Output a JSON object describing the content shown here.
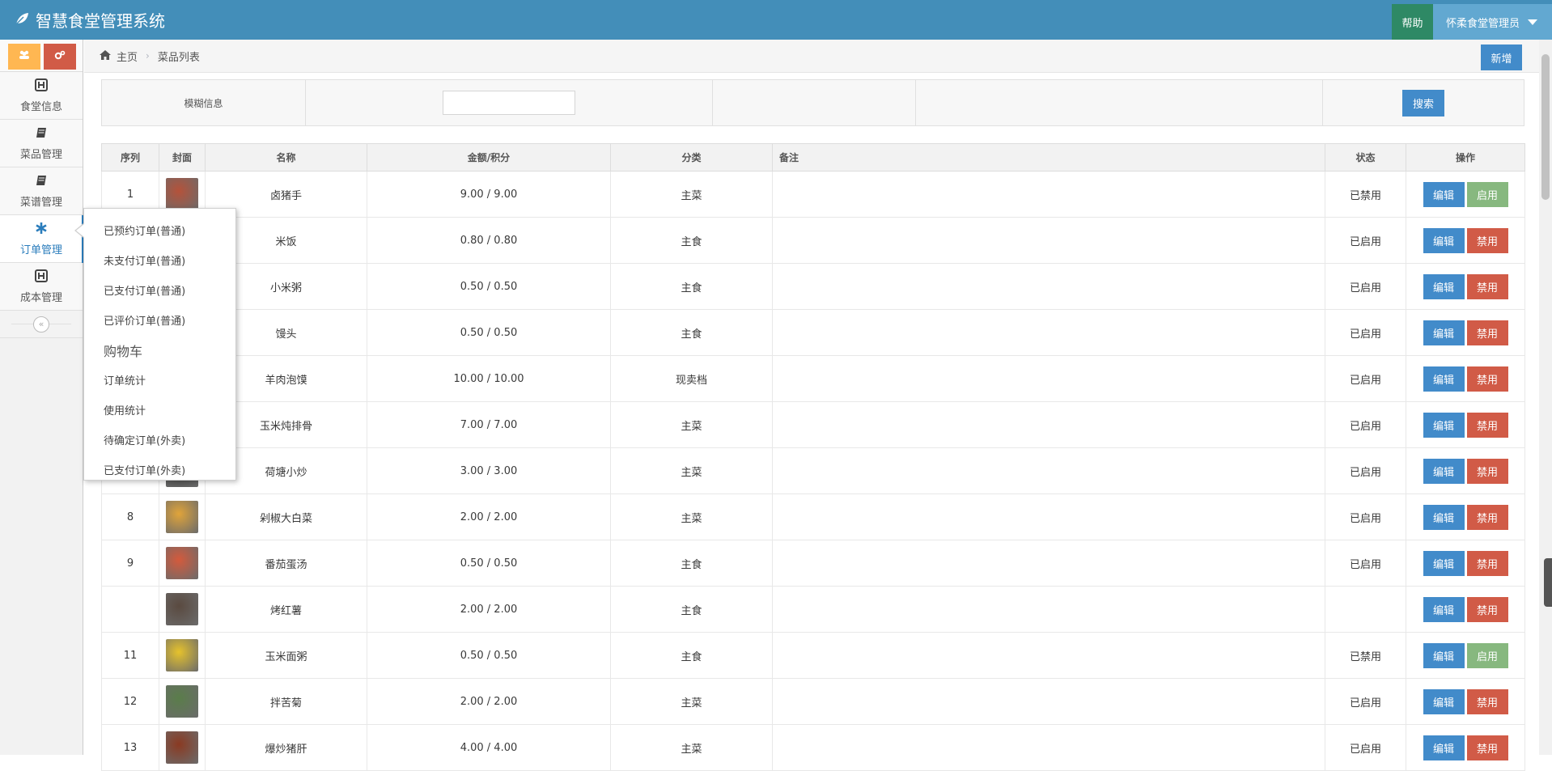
{
  "navbar": {
    "brand": "智慧食堂管理系统",
    "help": "帮助",
    "user": "怀柔食堂管理员",
    "bg_color": "#438eb9"
  },
  "sidebar": {
    "items": [
      {
        "label": "食堂信息",
        "icon": "hospital-h-icon"
      },
      {
        "label": "菜品管理",
        "icon": "book-icon"
      },
      {
        "label": "菜谱管理",
        "icon": "book-icon"
      },
      {
        "label": "订单管理",
        "icon": "asterisk-icon"
      },
      {
        "label": "成本管理",
        "icon": "hospital-h-icon"
      }
    ],
    "collapse_glyph": "«"
  },
  "breadcrumb": {
    "home": "主页",
    "current": "菜品列表"
  },
  "toolbar": {
    "new_label": "新增"
  },
  "search": {
    "label": "模糊信息",
    "value": "",
    "button": "搜索"
  },
  "table": {
    "headers": [
      "序列",
      "封面",
      "名称",
      "金额/积分",
      "分类",
      "备注",
      "状态",
      "操作"
    ],
    "edit_label": "编辑",
    "rows": [
      {
        "seq": "1",
        "name": "卤猪手",
        "price": "9.00 / 9.00",
        "category": "主菜",
        "note": "",
        "status": "已禁用",
        "toggle": "启用",
        "thumb": "#b5523a"
      },
      {
        "seq": "",
        "name": "米饭",
        "price": "0.80 / 0.80",
        "category": "主食",
        "note": "",
        "status": "已启用",
        "toggle": "禁用",
        "thumb": "#e9e2d0"
      },
      {
        "seq": "",
        "name": "小米粥",
        "price": "0.50 / 0.50",
        "category": "主食",
        "note": "",
        "status": "已启用",
        "toggle": "禁用",
        "thumb": "#e8c65c"
      },
      {
        "seq": "",
        "name": "馒头",
        "price": "0.50 / 0.50",
        "category": "主食",
        "note": "",
        "status": "已启用",
        "toggle": "禁用",
        "thumb": "#eeeadf"
      },
      {
        "seq": "",
        "name": "羊肉泡馍",
        "price": "10.00 / 10.00",
        "category": "现卖档",
        "note": "",
        "status": "已启用",
        "toggle": "禁用",
        "thumb": "#c9a27a"
      },
      {
        "seq": "",
        "name": "玉米炖排骨",
        "price": "7.00 / 7.00",
        "category": "主菜",
        "note": "",
        "status": "已启用",
        "toggle": "禁用",
        "thumb": "#d8a84a"
      },
      {
        "seq": "",
        "name": "荷塘小炒",
        "price": "3.00 / 3.00",
        "category": "主菜",
        "note": "",
        "status": "已启用",
        "toggle": "禁用",
        "thumb": "#4a4a48"
      },
      {
        "seq": "8",
        "name": "剁椒大白菜",
        "price": "2.00 / 2.00",
        "category": "主菜",
        "note": "",
        "status": "已启用",
        "toggle": "禁用",
        "thumb": "#e0a43a"
      },
      {
        "seq": "9",
        "name": "番茄蛋汤",
        "price": "0.50 / 0.50",
        "category": "主食",
        "note": "",
        "status": "已启用",
        "toggle": "禁用",
        "thumb": "#d45a3c"
      },
      {
        "seq": "",
        "name": "烤红薯",
        "price": "2.00 / 2.00",
        "category": "主食",
        "note": "",
        "status": "",
        "toggle": "禁用",
        "thumb": "#5a4a40"
      },
      {
        "seq": "11",
        "name": "玉米面粥",
        "price": "0.50 / 0.50",
        "category": "主食",
        "note": "",
        "status": "已禁用",
        "toggle": "启用",
        "thumb": "#e6c22c"
      },
      {
        "seq": "12",
        "name": "拌苦菊",
        "price": "2.00 / 2.00",
        "category": "主菜",
        "note": "",
        "status": "已启用",
        "toggle": "禁用",
        "thumb": "#5a7d4a"
      },
      {
        "seq": "13",
        "name": "爆炒猪肝",
        "price": "4.00 / 4.00",
        "category": "主菜",
        "note": "",
        "status": "已启用",
        "toggle": "禁用",
        "thumb": "#8a3a22"
      }
    ]
  },
  "order_menu": {
    "items": [
      {
        "label": "已预约订单(普通)",
        "type": "item"
      },
      {
        "label": "未支付订单(普通)",
        "type": "item"
      },
      {
        "label": "已支付订单(普通)",
        "type": "item"
      },
      {
        "label": "已评价订单(普通)",
        "type": "item"
      },
      {
        "label": "购物车",
        "type": "head"
      },
      {
        "label": "订单统计",
        "type": "item"
      },
      {
        "label": "使用统计",
        "type": "item"
      },
      {
        "label": "待确定订单(外卖)",
        "type": "item"
      },
      {
        "label": "已支付订单(外卖)",
        "type": "item"
      }
    ]
  }
}
